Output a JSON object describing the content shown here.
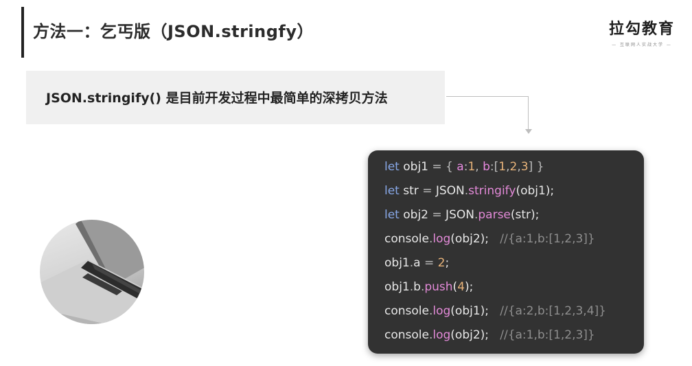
{
  "header": {
    "title": "方法一：乞丐版（JSON.stringfy）"
  },
  "logo": {
    "main": "拉勾教育",
    "sub": "— 互联网人实战大学 —"
  },
  "banner": {
    "text": "JSON.stringify() 是目前开发过程中最简单的深拷贝方法"
  },
  "code": {
    "l1": {
      "kw": "let",
      "rest1": " obj1 ",
      "eq": "=",
      "ob": " { ",
      "pa": "a",
      "c1": ":",
      "n1": "1",
      "cm": ", ",
      "pb": "b",
      "c2": ":",
      "arr": "[",
      "n2": "1",
      "cm2": ",",
      "n3": "2",
      "cm3": ",",
      "n4": "3",
      "arrc": "]",
      "cb": " }"
    },
    "l2": {
      "kw": "let",
      "rest": " str ",
      "eq": "=",
      "obj": " JSON",
      "dot": ".",
      "fn": "stringify",
      "args": "(obj1);"
    },
    "l3": {
      "kw": "let",
      "rest": " obj2 ",
      "eq": "=",
      "obj": " JSON",
      "dot": ".",
      "fn": "parse",
      "args": "(str);"
    },
    "l4": {
      "obj": "console",
      "dot": ".",
      "fn": "log",
      "args": "(obj2);",
      "comment": "   //{a:1,b:[1,2,3]}"
    },
    "l5": {
      "obj": "obj1",
      "dot": ".",
      "prop": "a",
      "eq": " = ",
      "num": "2",
      "end": ";"
    },
    "l6": {
      "obj": "obj1",
      "dot": ".",
      "prop": "b",
      "dot2": ".",
      "fn": "push",
      "open": "(",
      "num": "4",
      "close": ");"
    },
    "l7": {
      "obj": "console",
      "dot": ".",
      "fn": "log",
      "args": "(obj1);",
      "comment": "   //{a:2,b:[1,2,3,4]}"
    },
    "l8": {
      "obj": "console",
      "dot": ".",
      "fn": "log",
      "args": "(obj2);",
      "comment": "   //{a:1,b:[1,2,3]}"
    }
  },
  "photo": {
    "icon": "laptop-image"
  }
}
